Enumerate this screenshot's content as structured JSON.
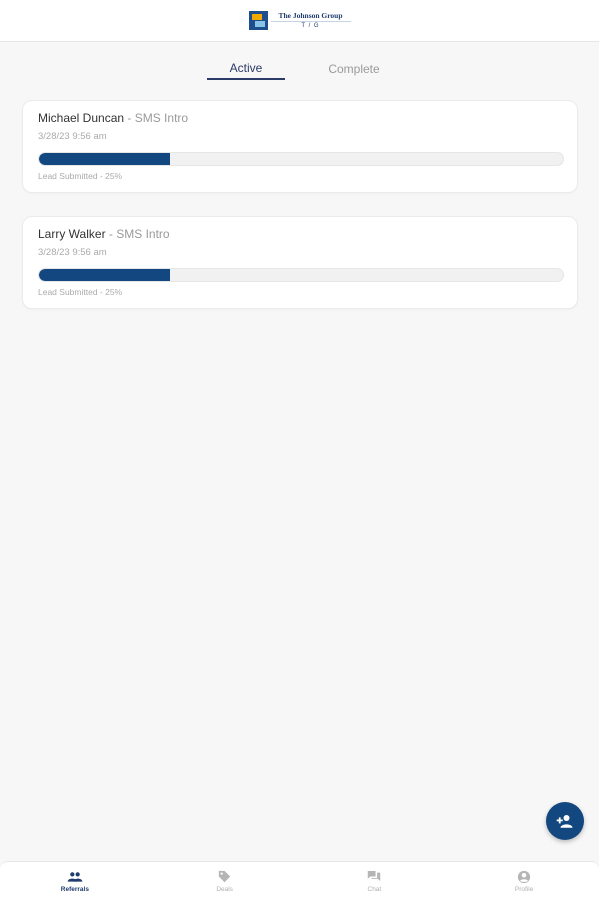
{
  "header": {
    "brand_name": "The Johnson Group",
    "brand_sub": "T / G"
  },
  "tabs": [
    {
      "label": "Active",
      "selected": true
    },
    {
      "label": "Complete",
      "selected": false
    }
  ],
  "referrals": [
    {
      "name": "Michael Duncan",
      "separator": " - ",
      "source": "SMS Intro",
      "date": "3/28/23 9:56 am",
      "status": "Lead Submitted - 25%",
      "progress_percent": 25
    },
    {
      "name": "Larry Walker",
      "separator": " - ",
      "source": "SMS Intro",
      "date": "3/28/23 9:56 am",
      "status": "Lead Submitted - 25%",
      "progress_percent": 25
    }
  ],
  "fab": {
    "icon": "add-person-icon"
  },
  "bottom_nav": [
    {
      "label": "Referrals",
      "icon": "people-icon",
      "active": true
    },
    {
      "label": "Deals",
      "icon": "tag-icon",
      "active": false
    },
    {
      "label": "Chat",
      "icon": "chat-icon",
      "active": false
    },
    {
      "label": "Profile",
      "icon": "profile-icon",
      "active": false
    }
  ],
  "colors": {
    "primary": "#13477f",
    "tab_active": "#2b3a67",
    "background": "#f7f7f7"
  }
}
